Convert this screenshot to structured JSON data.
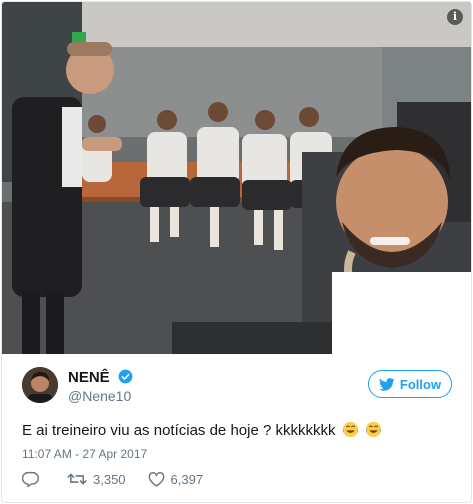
{
  "photo": {
    "info_icon": "info-icon",
    "description_icons": [
      "exit-sign",
      "headphones-icon"
    ]
  },
  "tweet": {
    "display_name": "NENÊ",
    "handle": "@Nene10",
    "verified_icon": "verified-badge-icon",
    "follow_label": "Follow",
    "follow_icon": "twitter-bird-icon",
    "text": "E ai treineiro viu as notícias de hoje ? kkkkkkkk",
    "emojis": [
      "face-with-tears-of-joy",
      "face-with-tears-of-joy"
    ],
    "timestamp": "11:07 AM - 27 Apr 2017",
    "actions": {
      "reply_icon": "reply-icon",
      "retweet_icon": "retweet-icon",
      "retweet_count": "3,350",
      "like_icon": "heart-icon",
      "like_count": "6,397"
    }
  },
  "colors": {
    "twitter_blue": "#1da1f2",
    "text_primary": "#14171a",
    "text_secondary": "#657786",
    "border": "#e1e8ed"
  }
}
